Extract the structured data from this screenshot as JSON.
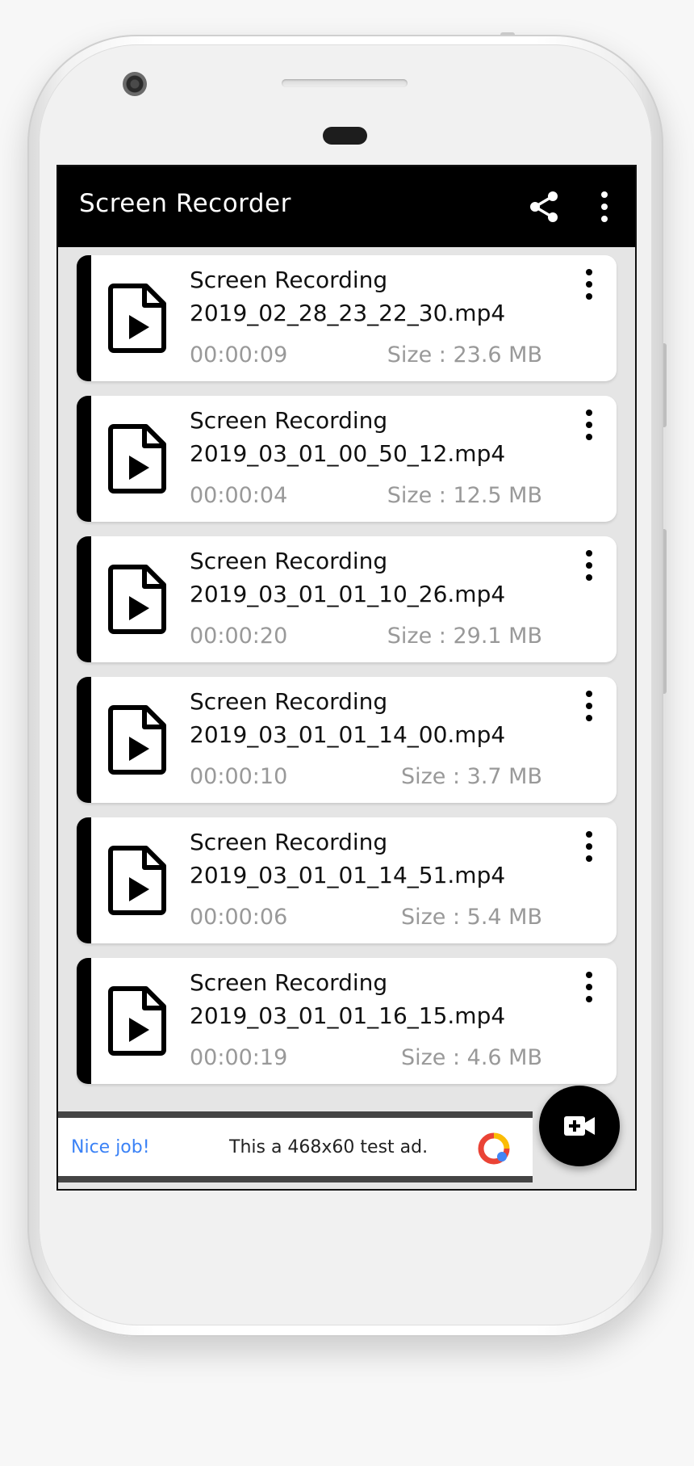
{
  "app": {
    "title": "Screen Recorder"
  },
  "toolbar": {
    "share_icon": "share-icon",
    "menu_icon": "more-vert-icon"
  },
  "recordings": [
    {
      "title": "Screen Recording",
      "filename": "2019_02_28_23_22_30.mp4",
      "duration": "00:00:09",
      "size": "Size : 23.6 MB"
    },
    {
      "title": "Screen Recording",
      "filename": "2019_03_01_00_50_12.mp4",
      "duration": "00:00:04",
      "size": "Size : 12.5 MB"
    },
    {
      "title": "Screen Recording",
      "filename": "2019_03_01_01_10_26.mp4",
      "duration": "00:00:20",
      "size": "Size : 29.1 MB"
    },
    {
      "title": "Screen Recording",
      "filename": "2019_03_01_01_14_00.mp4",
      "duration": "00:00:10",
      "size": "Size : 3.7 MB"
    },
    {
      "title": "Screen Recording",
      "filename": "2019_03_01_01_14_51.mp4",
      "duration": "00:00:06",
      "size": "Size : 5.4 MB"
    },
    {
      "title": "Screen Recording",
      "filename": "2019_03_01_01_16_15.mp4",
      "duration": "00:00:19",
      "size": "Size : 4.6 MB"
    }
  ],
  "ad": {
    "badge": "Nice job!",
    "text": "This a 468x60 test ad."
  },
  "fab": {
    "icon": "add-video-icon"
  },
  "colors": {
    "appbar": "#000000",
    "accent": "#000000",
    "ad_badge": "#3b82f6",
    "secondary_text": "#999999"
  }
}
